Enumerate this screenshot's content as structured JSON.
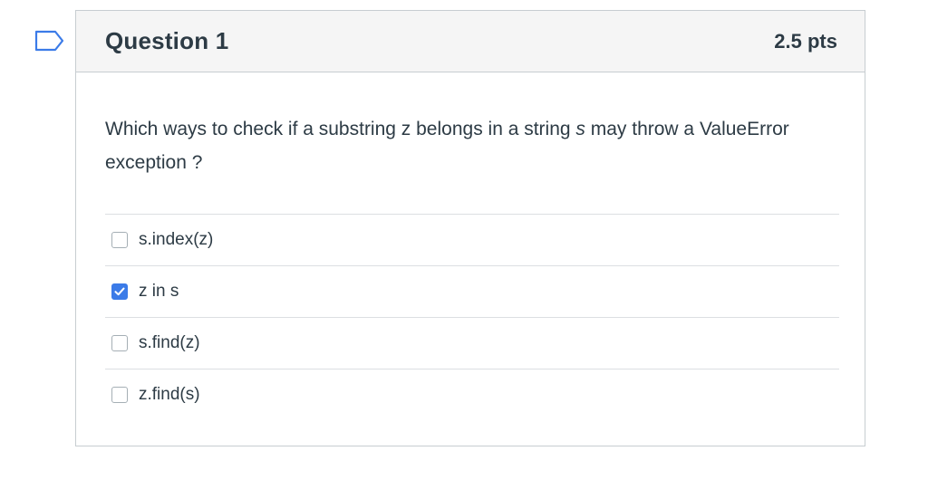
{
  "question": {
    "title": "Question 1",
    "points": "2.5 pts",
    "text_before": "Which ways to check if a substring z belongs in a string ",
    "text_var": "s",
    "text_after": " may throw a ValueError exception ?",
    "answers": [
      {
        "label": "s.index(z)",
        "checked": false
      },
      {
        "label": "z in s",
        "checked": true
      },
      {
        "label": "s.find(z)",
        "checked": false
      },
      {
        "label": "z.find(s)",
        "checked": false
      }
    ]
  },
  "colors": {
    "accent": "#3b7be8",
    "text": "#2d3b45",
    "header_bg": "#f5f5f5",
    "border": "#c7cdd1"
  },
  "icons": {
    "flag": "flag-question-icon",
    "check": "checkmark-icon"
  }
}
